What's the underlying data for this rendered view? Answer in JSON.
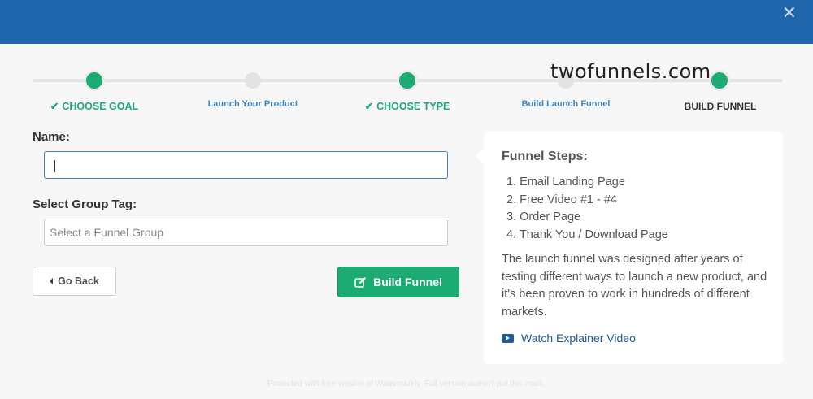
{
  "header": {
    "close_glyph": "✕"
  },
  "progress": {
    "steps": [
      {
        "label": "CHOOSE GOAL",
        "state": "done",
        "check": "✔"
      },
      {
        "label": "Launch Your Product",
        "state": "pending"
      },
      {
        "label": "CHOOSE TYPE",
        "state": "done",
        "check": "✔"
      },
      {
        "label": "Build Launch Funnel",
        "state": "pending"
      },
      {
        "label": "BUILD FUNNEL",
        "state": "current"
      }
    ]
  },
  "overlay_text": "twofunnels.com",
  "form": {
    "name_label": "Name:",
    "name_value": "",
    "group_label": "Select Group Tag:",
    "group_placeholder": "Select a Funnel Group",
    "back_label": "Go Back",
    "build_label": "Build Funnel"
  },
  "panel": {
    "title": "Funnel Steps:",
    "steps": [
      "1. Email Landing Page",
      "2. Free Video #1 - #4",
      "3. Order Page",
      "4. Thank You / Download Page"
    ],
    "description": "The launch funnel was designed after years of testing different ways to launch a new product, and it's been proven to work in hundreds of different markets.",
    "video_link": "Watch Explainer Video"
  },
  "footer_note": "Protected with free version of Watermarkly. Full version doesn't put this mark.",
  "colors": {
    "header": "#1f66ad",
    "accent": "#1cab73",
    "link": "#3f87c4"
  }
}
